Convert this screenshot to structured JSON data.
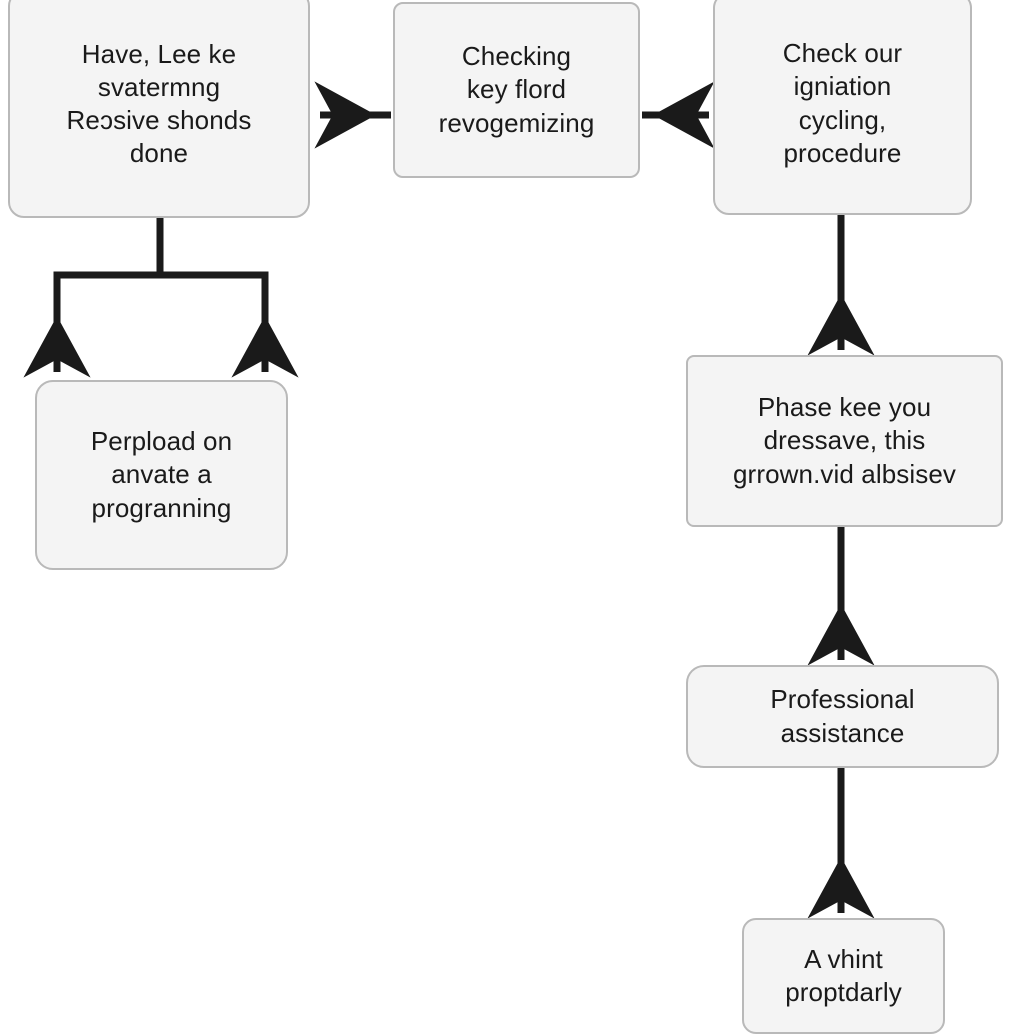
{
  "diagram": {
    "type": "flowchart",
    "background_color": "#ffffff",
    "node_fill_color": "#f4f4f4",
    "node_border_color": "#b9b9b9",
    "connector_color": "#1a1a1a",
    "text_color": "#1a1a1a",
    "nodes": [
      {
        "id": "have-lee",
        "label": "Have, Lee ke\nsvatermng\nReɔsive shonds\ndone",
        "shape": "rounded-rectangle"
      },
      {
        "id": "checking-key",
        "label": "Checking\nkey flord\nrevogemizing",
        "shape": "rounded-rectangle"
      },
      {
        "id": "check-ignition",
        "label": "Check our\nigniation\ncycling,\nprocedure",
        "shape": "rounded-rectangle"
      },
      {
        "id": "perpload",
        "label": "Perpload on\nanvate a\nprogranning",
        "shape": "rounded-rectangle"
      },
      {
        "id": "phase-kee",
        "label": "Phase kee you\ndressave, this\ngrrown.vid albsisev",
        "shape": "rounded-rectangle"
      },
      {
        "id": "professional",
        "label": "Professional\nassistance",
        "shape": "rounded-rectangle"
      },
      {
        "id": "a-vhint",
        "label": "A vhint\nproptdarly",
        "shape": "rounded-rectangle"
      }
    ],
    "edges": [
      {
        "id": "edge-checking-to-have",
        "from": "checking-key",
        "to": "have-lee",
        "direction": "left",
        "arrowhead": true
      },
      {
        "id": "edge-checking-to-ignition",
        "from": "checking-key",
        "to": "check-ignition",
        "direction": "right",
        "arrowhead": true
      },
      {
        "id": "edge-have-to-perpload-left",
        "from": "have-lee",
        "to": "perpload",
        "direction": "down",
        "arrowhead": true
      },
      {
        "id": "edge-have-to-perpload-right",
        "from": "have-lee",
        "to": "perpload",
        "direction": "down",
        "arrowhead": true
      },
      {
        "id": "edge-ignition-to-phase",
        "from": "check-ignition",
        "to": "phase-kee",
        "direction": "down",
        "arrowhead": true
      },
      {
        "id": "edge-phase-to-professional",
        "from": "phase-kee",
        "to": "professional",
        "direction": "down",
        "arrowhead": true
      },
      {
        "id": "edge-professional-to-vhint",
        "from": "professional",
        "to": "a-vhint",
        "direction": "down",
        "arrowhead": true
      }
    ]
  }
}
